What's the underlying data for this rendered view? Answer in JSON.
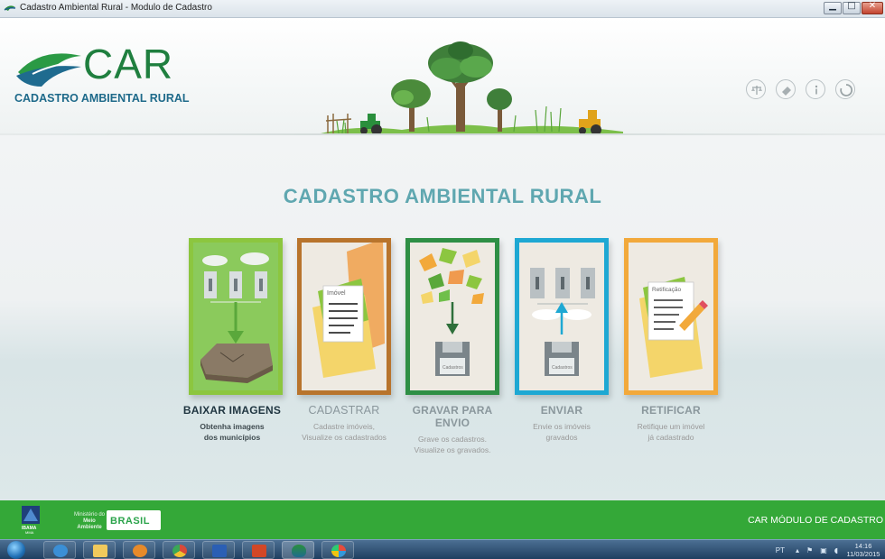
{
  "window": {
    "title": "Cadastro Ambiental Rural - Modulo de Cadastro",
    "controls": {
      "minimize": "▁",
      "maximize": "□",
      "close": "✕"
    }
  },
  "header": {
    "logo_word": "CAR",
    "logo_subtitle": "CADASTRO AMBIENTAL RURAL",
    "tools": [
      "scale-icon",
      "eraser-icon",
      "info-icon",
      "refresh-icon"
    ]
  },
  "main": {
    "title": "CADASTRO AMBIENTAL RURAL",
    "actions": [
      {
        "label": "BAIXAR IMAGENS",
        "line1": "Obtenha imagens",
        "line2": "dos municípios",
        "card_text": ""
      },
      {
        "label": "CADASTRAR",
        "line1": "Cadastre imóveis,",
        "line2": "Visualize os cadastrados",
        "card_text": "Imóvel"
      },
      {
        "label": "GRAVAR PARA ENVIO",
        "line1": "Grave os cadastros.",
        "line2": "Visualize os gravados.",
        "card_text": "Cadastros"
      },
      {
        "label": "ENVIAR",
        "line1": "Envie os imóveis",
        "line2": "gravados",
        "card_text": "Cadastros"
      },
      {
        "label": "RETIFICAR",
        "line1": "Retifique um imóvel",
        "line2": "já cadastrado",
        "card_text": "Retificação"
      }
    ]
  },
  "footer": {
    "ibama": "IBAMA",
    "mma": "MMA",
    "ministerio_line1": "Ministério do",
    "ministerio_line2": "Meio Ambiente",
    "brasil": "BRASIL",
    "module_title": "CAR  MÓDULO DE CADASTRO"
  },
  "taskbar": {
    "items": [
      "start-orb",
      "internet-explorer",
      "file-explorer",
      "media-player",
      "chrome",
      "word",
      "powerpoint",
      "car-app",
      "paint"
    ],
    "language": "PT",
    "time": "14:16",
    "date": "11/03/2015"
  },
  "colors": {
    "accent_green": "#34a838",
    "title_teal": "#5fa7b0",
    "card_1": "#8cc63f",
    "card_2": "#b8742c",
    "card_3": "#2e8f45",
    "card_4": "#1ea8d3",
    "card_5": "#f2a93b"
  }
}
